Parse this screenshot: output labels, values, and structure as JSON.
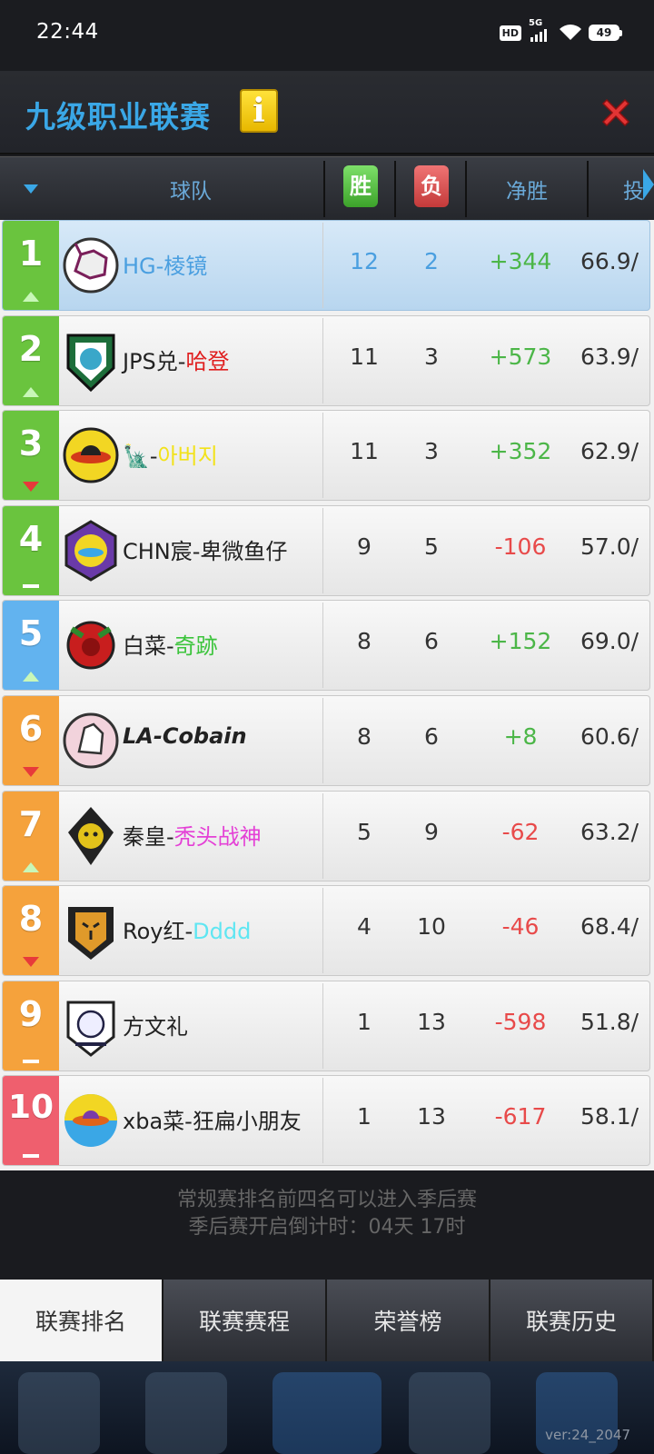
{
  "status_bar": {
    "time": "22:44",
    "hd": "HD",
    "network": "5G",
    "battery": "49"
  },
  "header": {
    "title": "九级职业联赛",
    "info_icon": "i"
  },
  "columns": {
    "team": "球队",
    "win": "胜",
    "loss": "负",
    "net": "净胜",
    "shot": "投"
  },
  "rows": [
    {
      "rank": "1",
      "rank_color": "#6ac43e",
      "trend": "up",
      "name1": "HG-棱镜",
      "name2": "",
      "name_color": "#4a9fe0",
      "w": "12",
      "l": "2",
      "net": "+344",
      "net_sign": "pos",
      "pct": "66.9/",
      "highlight": true,
      "logo": "rhino-logo"
    },
    {
      "rank": "2",
      "rank_color": "#6ac43e",
      "trend": "up",
      "name1": "JPS兑-",
      "name2": "哈登",
      "name2_color": "#e02020",
      "w": "11",
      "l": "3",
      "net": "+573",
      "net_sign": "pos",
      "pct": "63.9/",
      "logo": "spartan-logo"
    },
    {
      "rank": "3",
      "rank_color": "#6ac43e",
      "trend": "down",
      "name1": "🗽-",
      "name2": "아버지",
      "name2_color": "#f2e21a",
      "w": "11",
      "l": "3",
      "net": "+352",
      "net_sign": "pos",
      "pct": "62.9/",
      "logo": "ufo-yellow-logo"
    },
    {
      "rank": "4",
      "rank_color": "#6ac43e",
      "trend": "flat",
      "name1": "CHN宸-卑微鱼仔",
      "name2": "",
      "w": "9",
      "l": "5",
      "net": "-106",
      "net_sign": "neg",
      "pct": "57.0/",
      "logo": "ufo-purple-logo"
    },
    {
      "rank": "5",
      "rank_color": "#62b3ef",
      "trend": "up",
      "name1": "白菜-",
      "name2": "奇跡",
      "name2_color": "#3cc43c",
      "w": "8",
      "l": "6",
      "net": "+152",
      "net_sign": "pos",
      "pct": "69.0/",
      "logo": "red-bull-logo"
    },
    {
      "rank": "6",
      "rank_color": "#f5a23c",
      "trend": "down",
      "name1": "LA-Cobain",
      "name2": "",
      "bold_italic": true,
      "w": "8",
      "l": "6",
      "net": "+8",
      "net_sign": "pos",
      "pct": "60.6/",
      "logo": "wolf-logo"
    },
    {
      "rank": "7",
      "rank_color": "#f5a23c",
      "trend": "up",
      "name1": "秦皇-",
      "name2": "秃头战神",
      "name2_color": "#e440d6",
      "w": "5",
      "l": "9",
      "net": "-62",
      "net_sign": "neg",
      "pct": "63.2/",
      "logo": "snake-logo"
    },
    {
      "rank": "8",
      "rank_color": "#f5a23c",
      "trend": "down",
      "name1": "Roy红-",
      "name2": "Dddd",
      "name2_color": "#5fe6f2",
      "w": "4",
      "l": "10",
      "net": "-46",
      "net_sign": "neg",
      "pct": "68.4/",
      "logo": "tiger-logo"
    },
    {
      "rank": "9",
      "rank_color": "#f5a23c",
      "trend": "flat",
      "name1": "方文礼",
      "name2": "",
      "w": "1",
      "l": "13",
      "net": "-598",
      "net_sign": "neg",
      "pct": "51.8/",
      "logo": "bear-logo"
    },
    {
      "rank": "10",
      "rank_color": "#ef5f6e",
      "trend": "flat",
      "name1": "xba菜-狂扁小朋友",
      "name2": "",
      "w": "1",
      "l": "13",
      "net": "-617",
      "net_sign": "neg",
      "pct": "58.1/",
      "logo": "ufo-orange-logo"
    }
  ],
  "footer": {
    "line1": "常规赛排名前四名可以进入季后赛",
    "line2": "季后赛开启倒计时：04天 17时"
  },
  "tabs": [
    {
      "label": "联赛排名",
      "active": true
    },
    {
      "label": "联赛赛程",
      "active": false
    },
    {
      "label": "荣誉榜",
      "active": false
    },
    {
      "label": "联赛历史",
      "active": false
    }
  ],
  "version": "ver:24_2047"
}
